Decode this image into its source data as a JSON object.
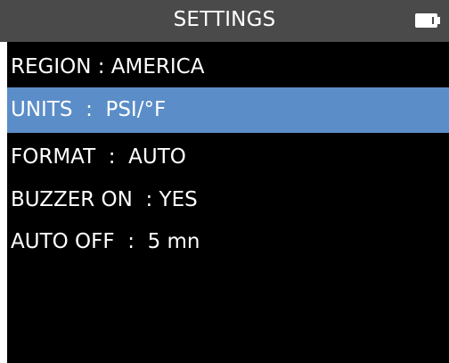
{
  "header": {
    "title": "SETTINGS",
    "battery_icon": "battery-icon",
    "battery_level": 0.9
  },
  "menu": {
    "items": [
      {
        "label": "REGION : AMERICA",
        "selected": false
      },
      {
        "label": "UNITS  :  PSI/°F",
        "selected": true
      },
      {
        "label": "FORMAT  :  AUTO",
        "selected": false
      },
      {
        "label": "BUZZER ON  : YES",
        "selected": false
      },
      {
        "label": "AUTO OFF  :  5 mn",
        "selected": false
      }
    ]
  },
  "colors": {
    "title_bar": "#4a4a4a",
    "background": "#000000",
    "selection": "#5b8dc8",
    "text": "#ffffff"
  }
}
